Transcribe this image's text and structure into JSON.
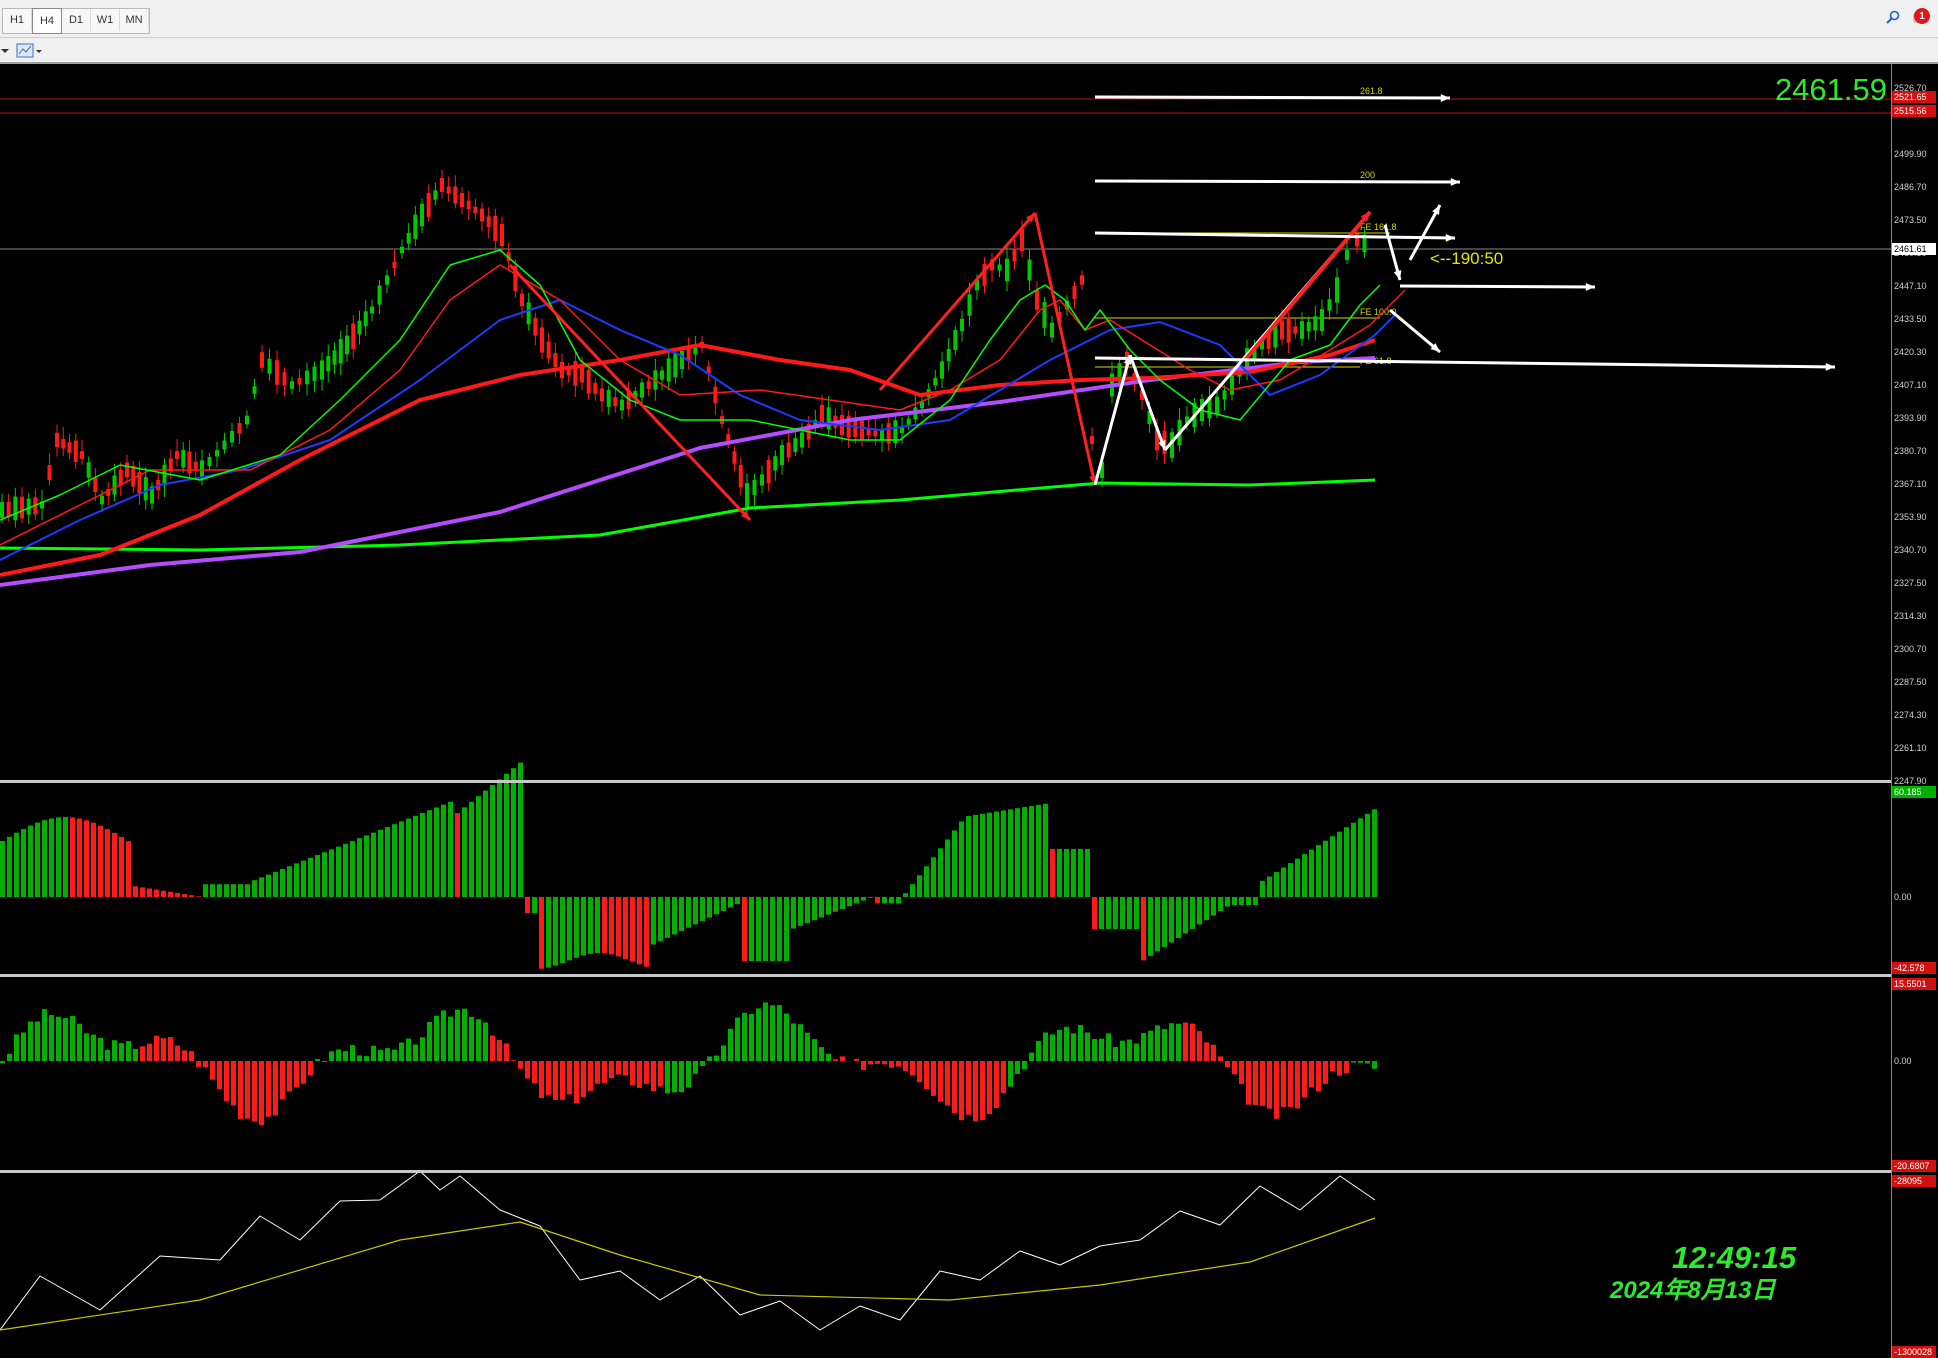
{
  "toolbar": {
    "timeframes": [
      {
        "label": "H1",
        "active": false
      },
      {
        "label": "H4",
        "active": true
      },
      {
        "label": "D1",
        "active": false
      },
      {
        "label": "W1",
        "active": false
      },
      {
        "label": "MN",
        "active": false
      }
    ],
    "notification_count": "1",
    "search_icon": "search-icon",
    "notification_icon": "bell-icon"
  },
  "chart": {
    "current_price_big": "2461.59",
    "current_price_tag": "2461.61",
    "target_label": "<--190:50",
    "fib_labels": [
      "261.8",
      "200",
      "FE 161.8",
      "FE 100.0",
      "FE 61.8"
    ],
    "level_tags": [
      "2521.65",
      "2515.56"
    ],
    "price_scale": [
      "2526.70",
      "2513.50",
      "2499.90",
      "2486.70",
      "2473.50",
      "2460.30",
      "2447.10",
      "2433.50",
      "2420.30",
      "2407.10",
      "2393.90",
      "2380.70",
      "2367.10",
      "2353.90",
      "2340.70",
      "2327.50",
      "2314.30",
      "2300.70",
      "2287.50",
      "2274.30",
      "2261.10",
      "2247.90"
    ],
    "colors": {
      "up_candle": "#00c800",
      "down_candle": "#ff1a1a",
      "ma_green": "#00ff00",
      "ma_red": "#ff1a1a",
      "ma_purple": "#b44cff",
      "ma_blue": "#1b3cff"
    }
  },
  "macd": {
    "scale": [
      "60.185",
      "0.00",
      "-42.578"
    ]
  },
  "osc": {
    "scale": [
      "15.5501",
      "0.00",
      "-20.6807"
    ]
  },
  "obv": {
    "scale": [
      "-28095",
      "-1300028"
    ]
  },
  "clock": {
    "time": "12:49:15",
    "date": "2024年8月13日"
  }
}
